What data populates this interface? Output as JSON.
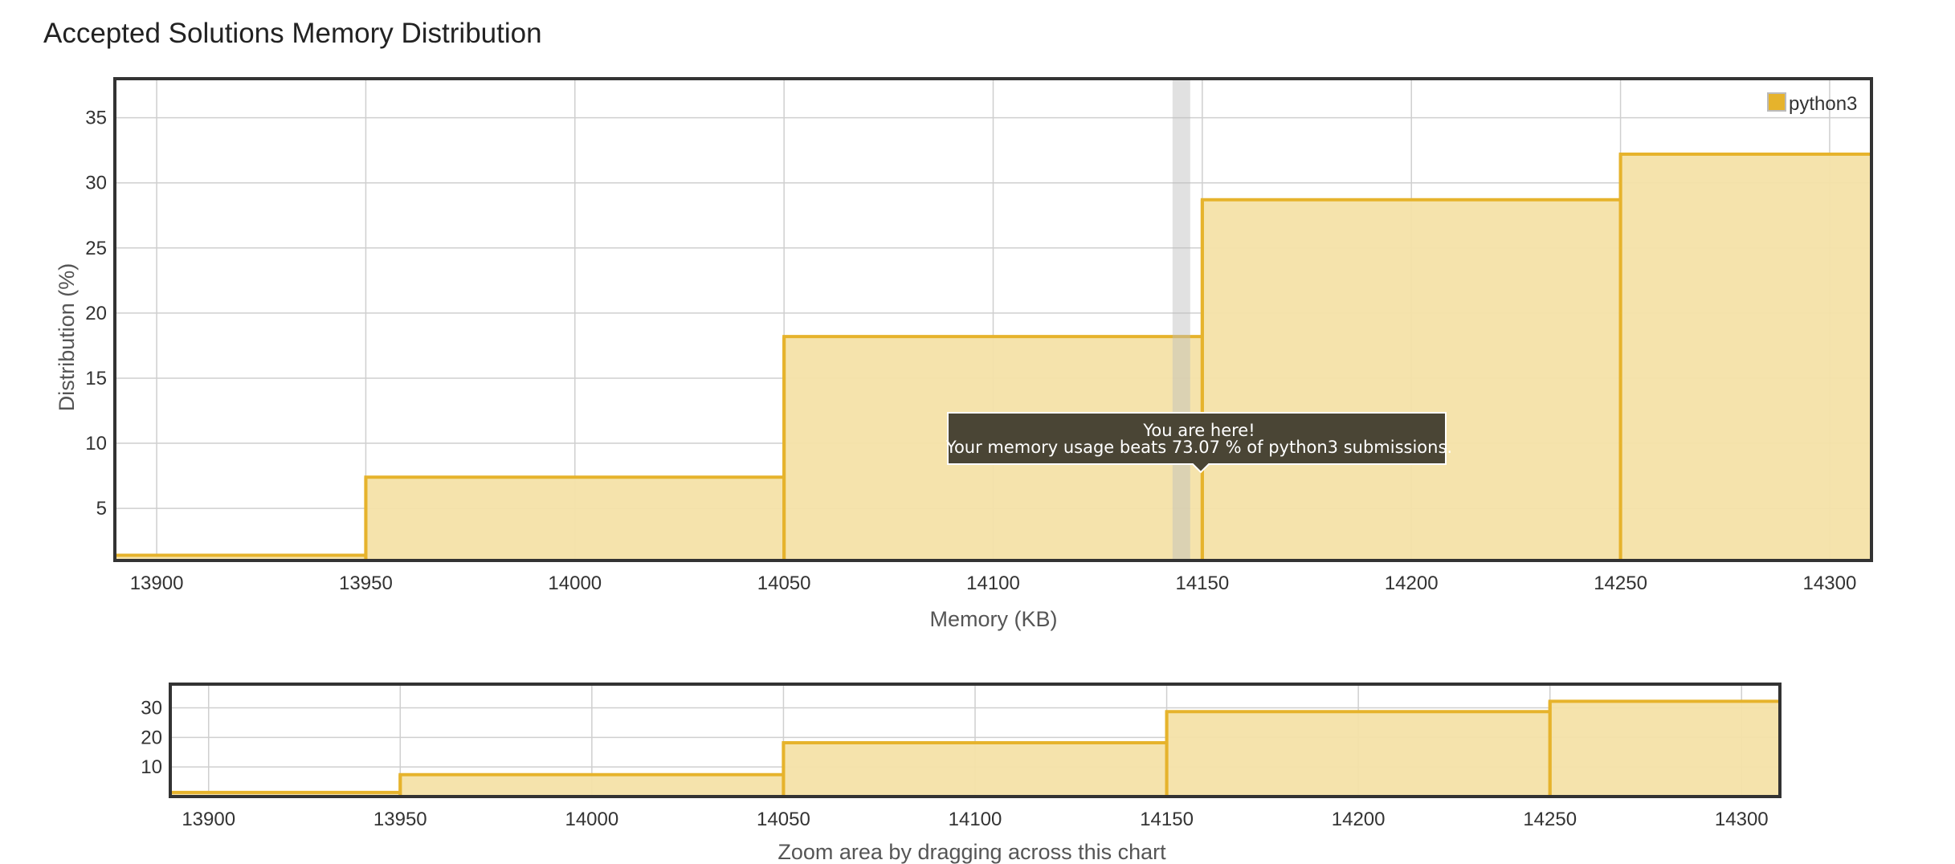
{
  "title": "Accepted Solutions Memory Distribution",
  "chart_data": [
    {
      "type": "area",
      "step": true,
      "title": "Accepted Solutions Memory Distribution",
      "xlabel": "Memory (KB)",
      "ylabel": "Distribution (%)",
      "xlim": [
        13890,
        14310
      ],
      "ylim": [
        1,
        38
      ],
      "xticks": [
        13900,
        13950,
        14000,
        14050,
        14100,
        14150,
        14200,
        14250,
        14300
      ],
      "yticks": [
        5,
        10,
        15,
        20,
        25,
        30,
        35
      ],
      "grid": true,
      "legend_position": "top-right",
      "series": [
        {
          "name": "python3",
          "color": "#e6b32c",
          "fill": "#f4e1a8",
          "bins": [
            {
              "x0": 13890,
              "x1": 13950,
              "y": 1.4
            },
            {
              "x0": 13950,
              "x1": 14050,
              "y": 7.4
            },
            {
              "x0": 14050,
              "x1": 14150,
              "y": 18.2
            },
            {
              "x0": 14150,
              "x1": 14250,
              "y": 28.7
            },
            {
              "x0": 14250,
              "x1": 14310,
              "y": 32.2
            }
          ]
        }
      ],
      "highlight_x": 14145,
      "tooltip": {
        "line1": "You are here!",
        "line2": "Your memory usage beats 73.07 % of python3 submissions."
      }
    },
    {
      "type": "area",
      "step": true,
      "role": "navigator",
      "xlim": [
        13890,
        14310
      ],
      "ylim": [
        0,
        38
      ],
      "xticks": [
        13900,
        13950,
        14000,
        14050,
        14100,
        14150,
        14200,
        14250,
        14300
      ],
      "yticks": [
        10,
        20,
        30
      ],
      "caption": "Zoom area by dragging across this chart"
    }
  ]
}
